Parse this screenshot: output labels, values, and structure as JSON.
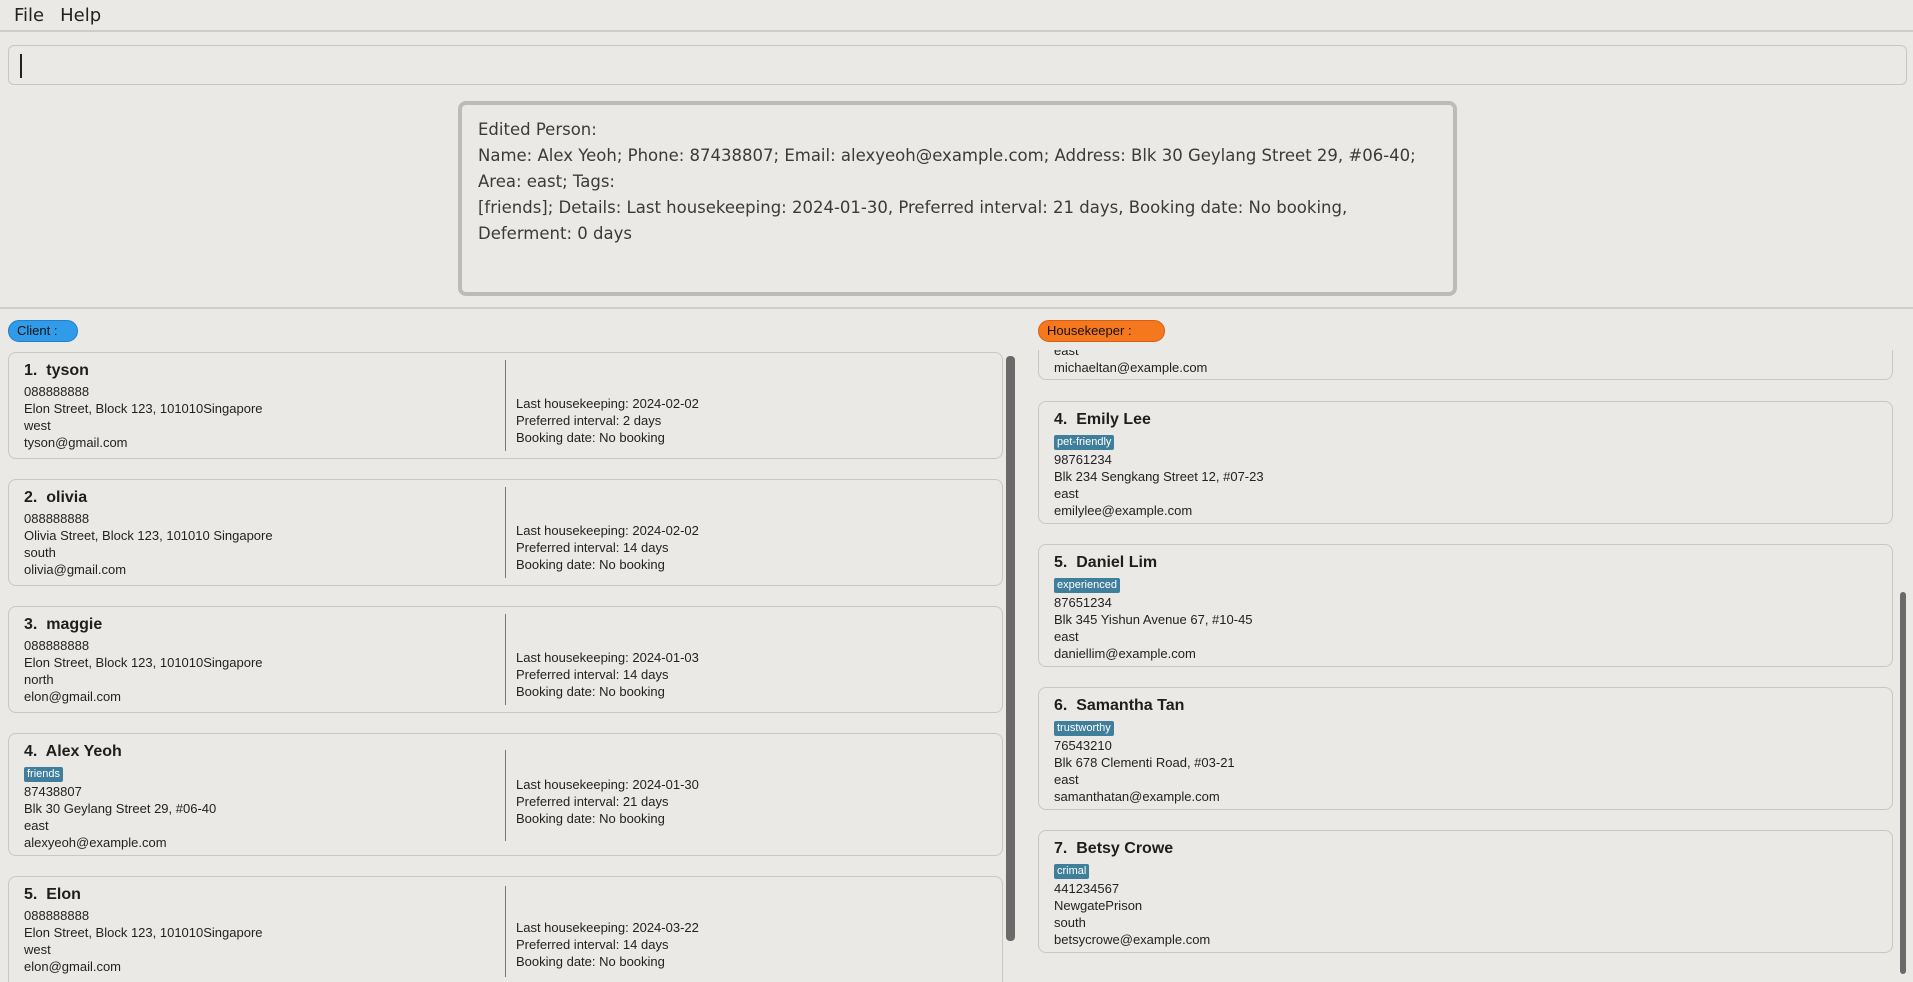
{
  "menu": {
    "file": "File",
    "help": "Help"
  },
  "command_box": {
    "value": ""
  },
  "result": {
    "line1": "Edited Person:",
    "line2": "Name: Alex Yeoh; Phone: 87438807; Email: alexyeoh@example.com; Address: Blk 30 Geylang Street 29, #06-40; Area: east; Tags:",
    "line3": "[friends]; Details: Last housekeeping: 2024-01-30, Preferred interval: 21 days, Booking date: No booking, Deferment: 0 days"
  },
  "client_label": "Client :",
  "housekeeper_label": "Housekeeper :",
  "clients": [
    {
      "index": "1.",
      "name": "tyson",
      "phone": "088888888",
      "address": "Elon Street, Block 123, 101010Singapore",
      "area": "west",
      "email": "tyson@gmail.com",
      "last": "Last housekeeping: 2024-02-02",
      "interval": "Preferred interval: 2 days",
      "booking": "Booking date: No booking"
    },
    {
      "index": "2.",
      "name": "olivia",
      "phone": "088888888",
      "address": "Olivia Street, Block 123, 101010 Singapore",
      "area": "south",
      "email": "olivia@gmail.com",
      "last": "Last housekeeping: 2024-02-02",
      "interval": "Preferred interval: 14 days",
      "booking": "Booking date: No booking"
    },
    {
      "index": "3.",
      "name": "maggie",
      "phone": "088888888",
      "address": "Elon Street, Block 123, 101010Singapore",
      "area": "north",
      "email": "elon@gmail.com",
      "last": "Last housekeeping: 2024-01-03",
      "interval": "Preferred interval: 14 days",
      "booking": "Booking date: No booking"
    },
    {
      "index": "4.",
      "name": "Alex Yeoh",
      "tag": "friends",
      "phone": "87438807",
      "address": "Blk 30 Geylang Street 29, #06-40",
      "area": "east",
      "email": "alexyeoh@example.com",
      "last": "Last housekeeping: 2024-01-30",
      "interval": "Preferred interval: 21 days",
      "booking": "Booking date: No booking"
    },
    {
      "index": "5.",
      "name": "Elon",
      "phone": "088888888",
      "address": "Elon Street, Block 123, 101010Singapore",
      "area": "west",
      "email": "elon@gmail.com",
      "last": "Last housekeeping: 2024-03-22",
      "interval": "Preferred interval: 14 days",
      "booking": "Booking date: No booking"
    }
  ],
  "housekeepers_partial": {
    "area": "east",
    "email": "michaeltan@example.com"
  },
  "housekeepers": [
    {
      "index": "4.",
      "name": "Emily Lee",
      "tag": "pet-friendly",
      "phone": "98761234",
      "address": "Blk 234 Sengkang Street 12, #07-23",
      "area": "east",
      "email": "emilylee@example.com"
    },
    {
      "index": "5.",
      "name": "Daniel Lim",
      "tag": "experienced",
      "phone": "87651234",
      "address": "Blk 345 Yishun Avenue 67, #10-45",
      "area": "east",
      "email": "daniellim@example.com"
    },
    {
      "index": "6.",
      "name": "Samantha Tan",
      "tag": "trustworthy",
      "phone": "76543210",
      "address": "Blk 678 Clementi Road, #03-21",
      "area": "east",
      "email": "samanthatan@example.com"
    },
    {
      "index": "7.",
      "name": "Betsy Crowe",
      "tag": "crimal",
      "phone": "441234567",
      "address": "NewgatePrison",
      "area": "south",
      "email": "betsycrowe@example.com"
    }
  ],
  "colors": {
    "client_accent": "#2f9be9",
    "housekeeper_accent": "#f5781f",
    "tag_bg": "#3f7f9b"
  }
}
